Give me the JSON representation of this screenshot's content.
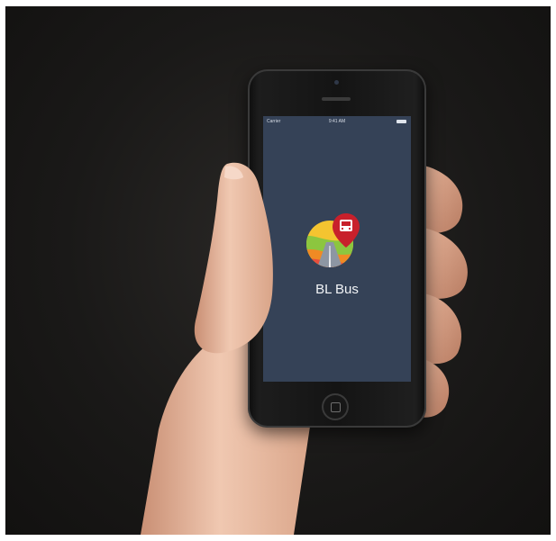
{
  "status_bar": {
    "carrier": "Carrier",
    "time": "9:41 AM"
  },
  "app": {
    "name": "BL Bus",
    "icon": "bus-location-pin-icon",
    "screen_color": "#354257"
  }
}
